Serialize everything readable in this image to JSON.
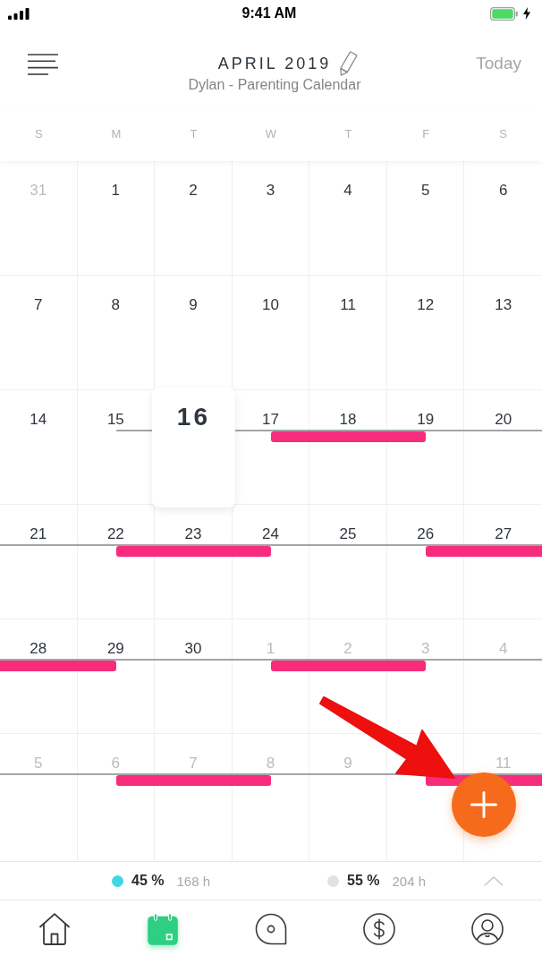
{
  "status_bar": {
    "time": "9:41 AM"
  },
  "header": {
    "title": "APRIL 2019",
    "subtitle": "Dylan - Parenting Calendar",
    "today_button": "Today"
  },
  "weekdays": [
    "S",
    "M",
    "T",
    "W",
    "T",
    "F",
    "S"
  ],
  "weeks": [
    [
      {
        "label": "31",
        "in_month": false,
        "today": false,
        "timeline_start": false,
        "event": false
      },
      {
        "label": "1",
        "in_month": true,
        "today": false,
        "timeline_start": false,
        "event": false
      },
      {
        "label": "2",
        "in_month": true,
        "today": false,
        "timeline_start": false,
        "event": false
      },
      {
        "label": "3",
        "in_month": true,
        "today": false,
        "timeline_start": false,
        "event": false
      },
      {
        "label": "4",
        "in_month": true,
        "today": false,
        "timeline_start": false,
        "event": false
      },
      {
        "label": "5",
        "in_month": true,
        "today": false,
        "timeline_start": false,
        "event": false
      },
      {
        "label": "6",
        "in_month": true,
        "today": false,
        "timeline_start": false,
        "event": false
      }
    ],
    [
      {
        "label": "7",
        "in_month": true,
        "today": false,
        "timeline_start": false,
        "event": false
      },
      {
        "label": "8",
        "in_month": true,
        "today": false,
        "timeline_start": false,
        "event": false
      },
      {
        "label": "9",
        "in_month": true,
        "today": false,
        "timeline_start": false,
        "event": false
      },
      {
        "label": "10",
        "in_month": true,
        "today": false,
        "timeline_start": false,
        "event": false
      },
      {
        "label": "11",
        "in_month": true,
        "today": false,
        "timeline_start": false,
        "event": false
      },
      {
        "label": "12",
        "in_month": true,
        "today": false,
        "timeline_start": false,
        "event": false
      },
      {
        "label": "13",
        "in_month": true,
        "today": false,
        "timeline_start": false,
        "event": false
      }
    ],
    [
      {
        "label": "14",
        "in_month": true,
        "today": false,
        "timeline_start": false,
        "event": false
      },
      {
        "label": "15",
        "in_month": true,
        "today": false,
        "timeline_start": true,
        "event": false
      },
      {
        "label": "16",
        "in_month": true,
        "today": true,
        "timeline_start": false,
        "event": false
      },
      {
        "label": "17",
        "in_month": true,
        "today": false,
        "timeline_start": false,
        "event": true
      },
      {
        "label": "18",
        "in_month": true,
        "today": false,
        "timeline_start": false,
        "event": true
      },
      {
        "label": "19",
        "in_month": true,
        "today": false,
        "timeline_start": false,
        "event": true
      },
      {
        "label": "20",
        "in_month": true,
        "today": false,
        "timeline_start": false,
        "event": false
      }
    ],
    [
      {
        "label": "21",
        "in_month": true,
        "today": false,
        "timeline_start": false,
        "event": false
      },
      {
        "label": "22",
        "in_month": true,
        "today": false,
        "timeline_start": false,
        "event": true
      },
      {
        "label": "23",
        "in_month": true,
        "today": false,
        "timeline_start": false,
        "event": true
      },
      {
        "label": "24",
        "in_month": true,
        "today": false,
        "timeline_start": false,
        "event": true
      },
      {
        "label": "25",
        "in_month": true,
        "today": false,
        "timeline_start": false,
        "event": false
      },
      {
        "label": "26",
        "in_month": true,
        "today": false,
        "timeline_start": false,
        "event": true
      },
      {
        "label": "27",
        "in_month": true,
        "today": false,
        "timeline_start": false,
        "event": true
      }
    ],
    [
      {
        "label": "28",
        "in_month": true,
        "today": false,
        "timeline_start": false,
        "event": true
      },
      {
        "label": "29",
        "in_month": true,
        "today": false,
        "timeline_start": false,
        "event": true
      },
      {
        "label": "30",
        "in_month": true,
        "today": false,
        "timeline_start": false,
        "event": false
      },
      {
        "label": "1",
        "in_month": false,
        "today": false,
        "timeline_start": false,
        "event": true
      },
      {
        "label": "2",
        "in_month": false,
        "today": false,
        "timeline_start": false,
        "event": true
      },
      {
        "label": "3",
        "in_month": false,
        "today": false,
        "timeline_start": false,
        "event": true
      },
      {
        "label": "4",
        "in_month": false,
        "today": false,
        "timeline_start": false,
        "event": false
      }
    ],
    [
      {
        "label": "5",
        "in_month": false,
        "today": false,
        "timeline_start": false,
        "event": false
      },
      {
        "label": "6",
        "in_month": false,
        "today": false,
        "timeline_start": false,
        "event": true
      },
      {
        "label": "7",
        "in_month": false,
        "today": false,
        "timeline_start": false,
        "event": true
      },
      {
        "label": "8",
        "in_month": false,
        "today": false,
        "timeline_start": false,
        "event": true
      },
      {
        "label": "9",
        "in_month": false,
        "today": false,
        "timeline_start": false,
        "event": false
      },
      {
        "timeline_start": false,
        "event": true
      },
      {
        "label": "11",
        "in_month": false,
        "today": false,
        "timeline_start": false,
        "event": true
      }
    ]
  ],
  "summary": [
    {
      "color": "#3ed8e4",
      "percent": "45 %",
      "hours": "168 h"
    },
    {
      "color": "#dfe2e5",
      "percent": "55 %",
      "hours": "204 h"
    }
  ],
  "tabs": [
    {
      "selected": false
    },
    {
      "selected": true
    },
    {
      "selected": false
    },
    {
      "selected": false
    },
    {
      "selected": false
    }
  ]
}
